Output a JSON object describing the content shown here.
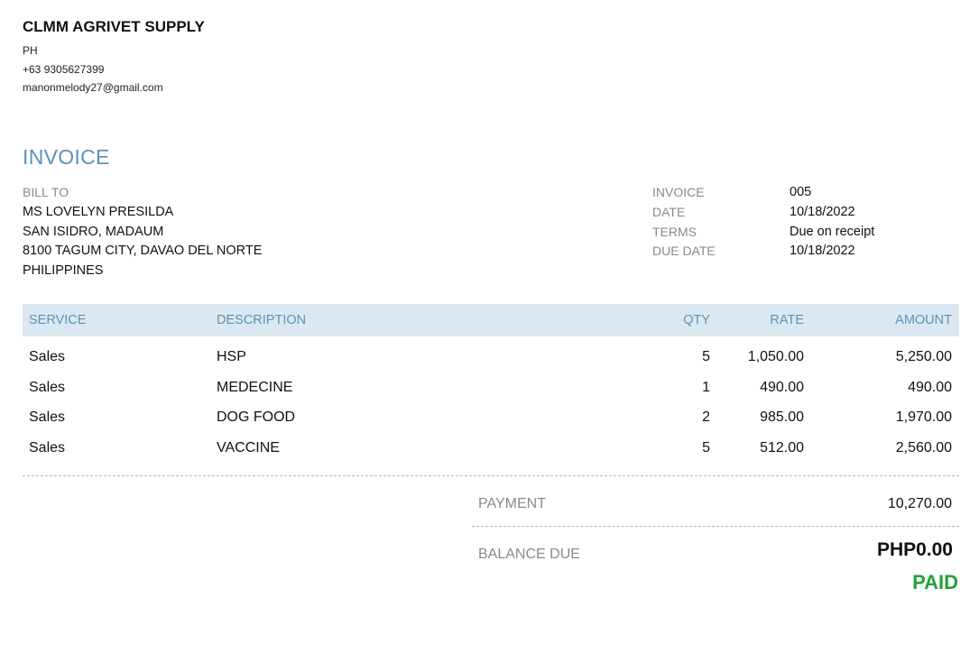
{
  "company": {
    "name": "CLMM AGRIVET SUPPLY",
    "country": "PH",
    "phone": "+63 9305627399",
    "email": "manonmelody27@gmail.com"
  },
  "document": {
    "title": "INVOICE"
  },
  "bill_to": {
    "label": "BILL TO",
    "name": "MS LOVELYN PRESILDA",
    "address1": "SAN ISIDRO, MADAUM",
    "address2": "8100 TAGUM CITY, DAVAO DEL NORTE",
    "country": "PHILIPPINES"
  },
  "meta": [
    {
      "label": "INVOICE",
      "value": "005"
    },
    {
      "label": "DATE",
      "value": "10/18/2022"
    },
    {
      "label": "TERMS",
      "value": "Due on receipt"
    },
    {
      "label": "DUE DATE",
      "value": "10/18/2022"
    }
  ],
  "table": {
    "headers": {
      "service": "SERVICE",
      "description": "DESCRIPTION",
      "qty": "QTY",
      "rate": "RATE",
      "amount": "AMOUNT"
    },
    "rows": [
      {
        "service": "Sales",
        "description": "HSP",
        "qty": "5",
        "rate": "1,050.00",
        "amount": "5,250.00"
      },
      {
        "service": "Sales",
        "description": "MEDECINE",
        "qty": "1",
        "rate": "490.00",
        "amount": "490.00"
      },
      {
        "service": "Sales",
        "description": "DOG FOOD",
        "qty": "2",
        "rate": "985.00",
        "amount": "1,970.00"
      },
      {
        "service": "Sales",
        "description": "VACCINE",
        "qty": "5",
        "rate": "512.00",
        "amount": "2,560.00"
      }
    ]
  },
  "summary": {
    "payment_label": "PAYMENT",
    "payment_value": "10,270.00",
    "balance_label": "BALANCE DUE",
    "balance_value": "PHP0.00",
    "status": "PAID",
    "status_color": "#22a339",
    "accent_color": "#5b92b8",
    "header_bg": "#dce8f1"
  }
}
